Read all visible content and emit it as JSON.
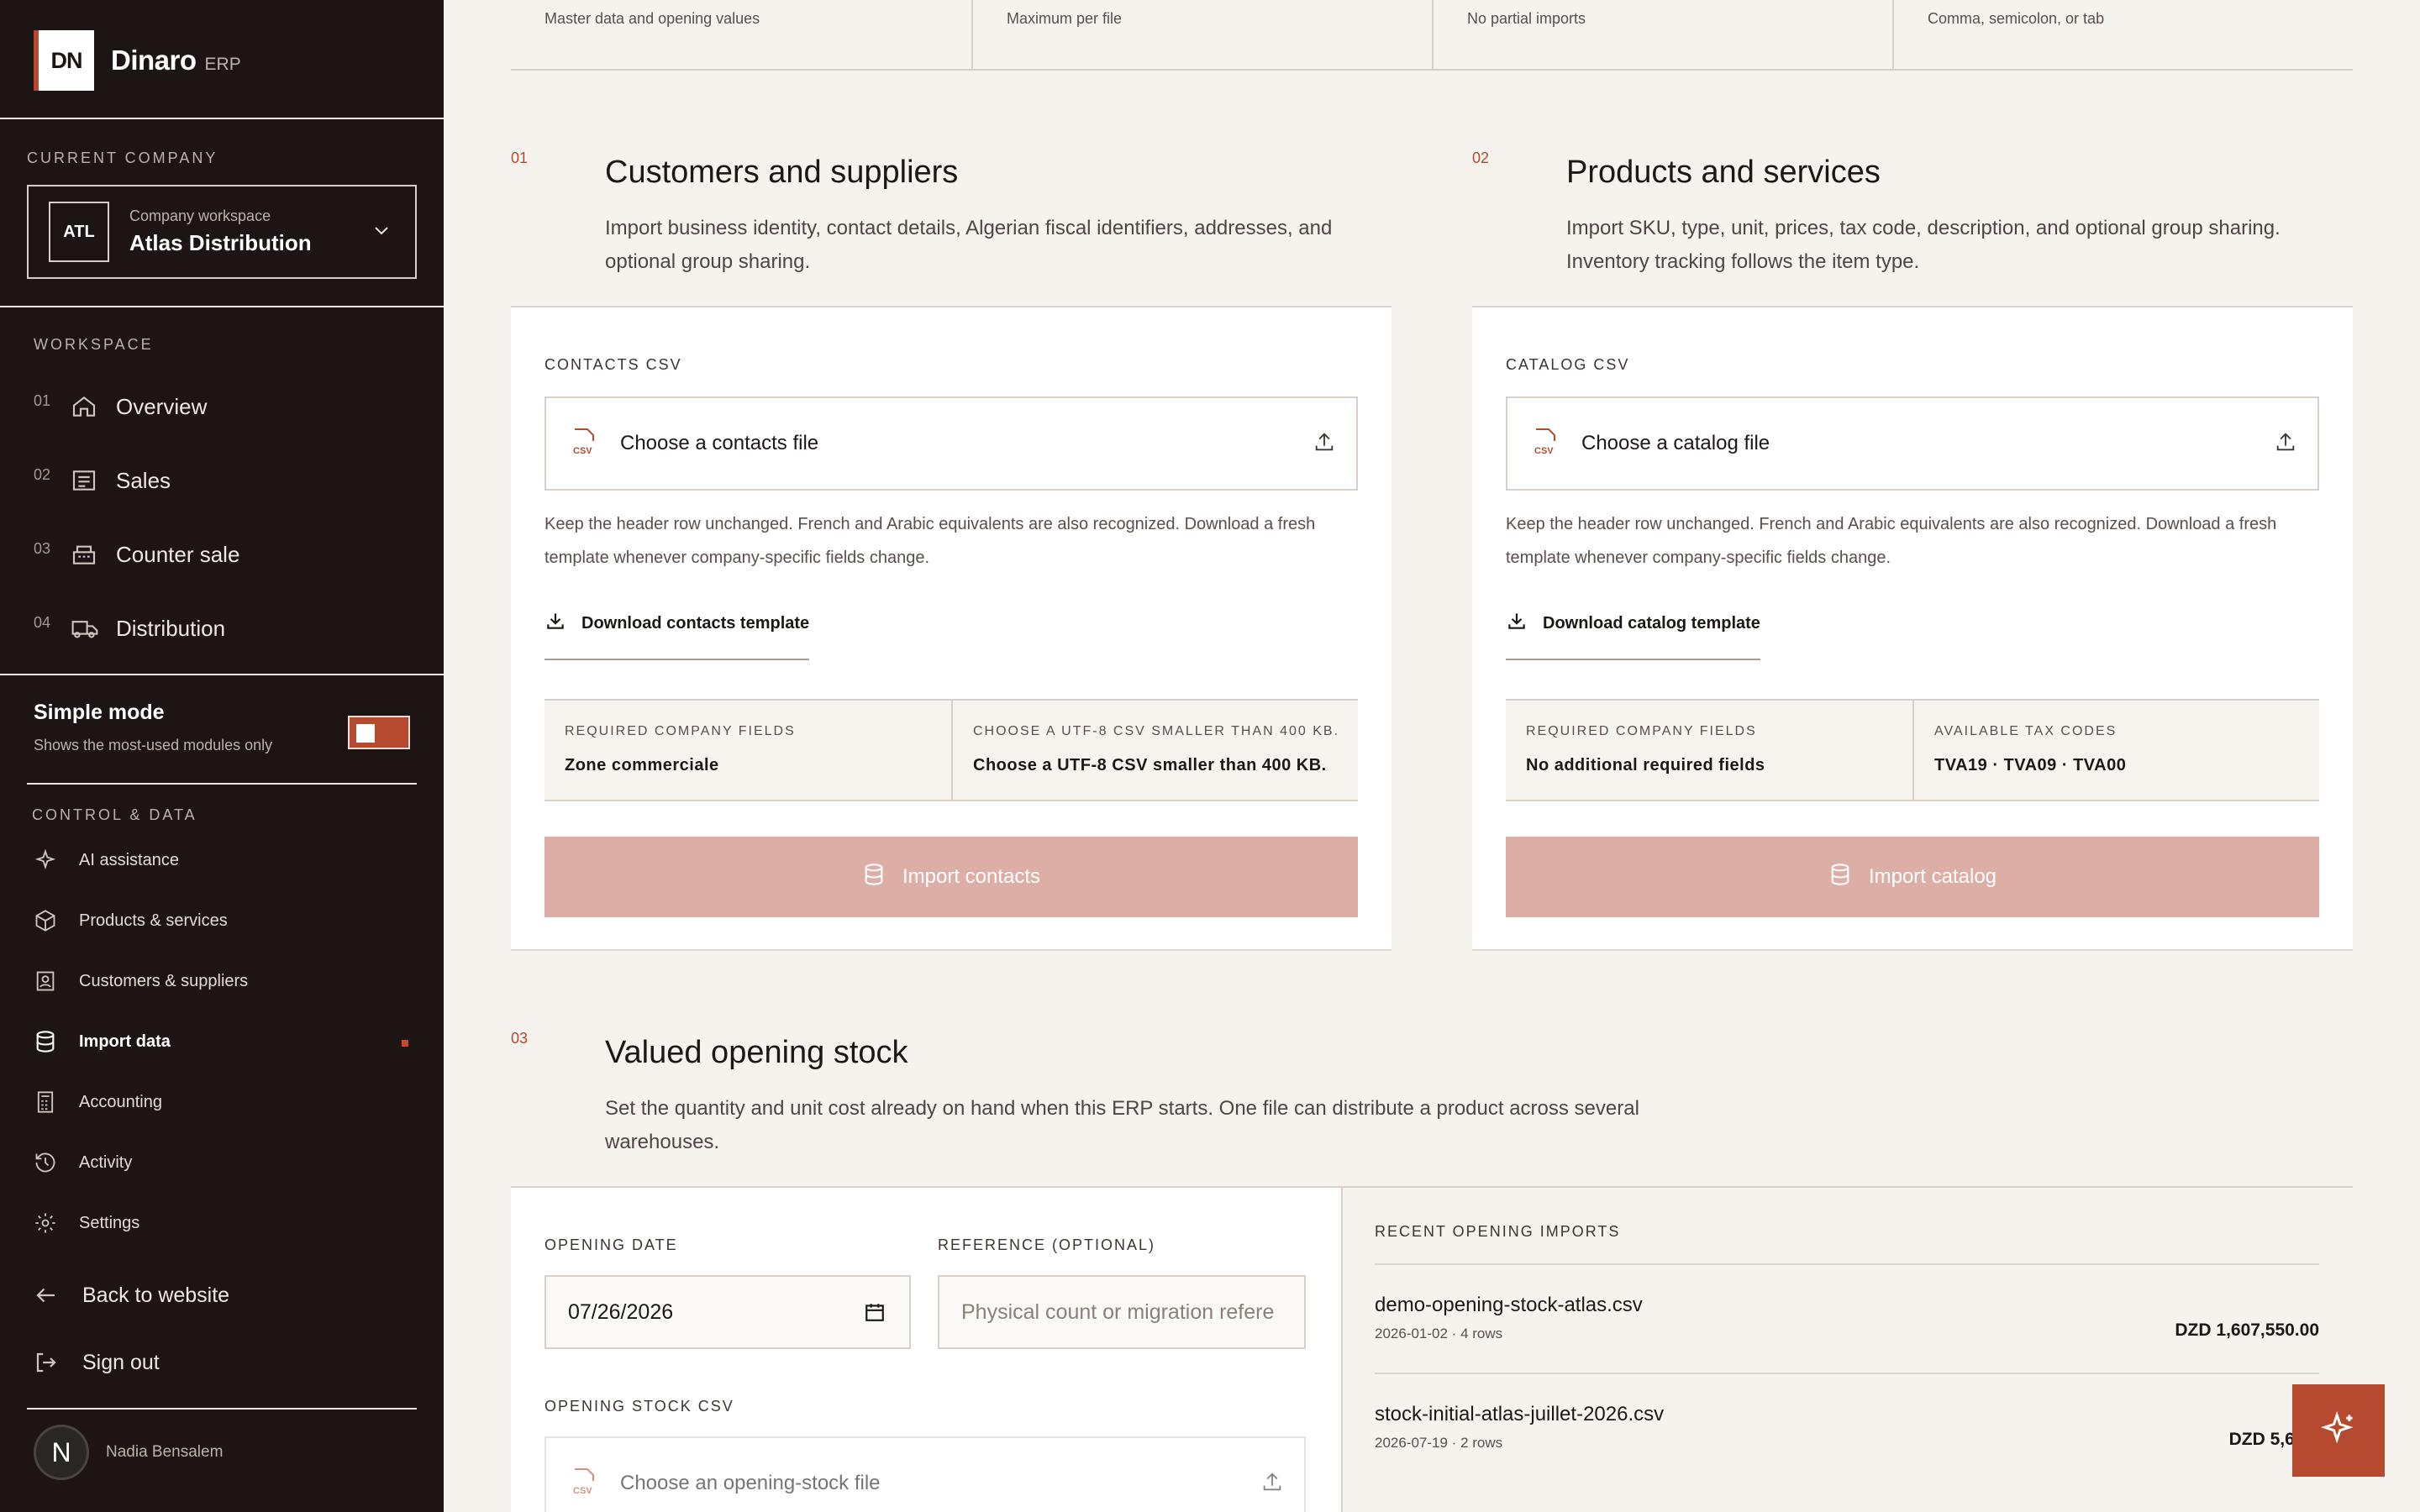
{
  "brand": {
    "logo": "DN",
    "name": "Dinaro",
    "suffix": "ERP"
  },
  "company": {
    "section_label": "CURRENT COMPANY",
    "badge": "ATL",
    "small": "Company workspace",
    "name": "Atlas Distribution"
  },
  "workspace": {
    "label": "WORKSPACE",
    "items": [
      {
        "num": "01",
        "label": "Overview",
        "icon": "home-icon"
      },
      {
        "num": "02",
        "label": "Sales",
        "icon": "receipt-icon"
      },
      {
        "num": "03",
        "label": "Counter sale",
        "icon": "register-icon"
      },
      {
        "num": "04",
        "label": "Distribution",
        "icon": "truck-icon"
      }
    ]
  },
  "simple_mode": {
    "title": "Simple mode",
    "subtitle": "Shows the most-used modules only",
    "enabled": true
  },
  "control": {
    "label": "CONTROL & DATA",
    "items": [
      {
        "label": "AI assistance",
        "icon": "sparkle-icon"
      },
      {
        "label": "Products & services",
        "icon": "box-icon"
      },
      {
        "label": "Customers & suppliers",
        "icon": "contact-icon"
      },
      {
        "label": "Import data",
        "icon": "database-icon",
        "active": true
      },
      {
        "label": "Accounting",
        "icon": "calculator-icon"
      },
      {
        "label": "Activity",
        "icon": "history-icon"
      },
      {
        "label": "Settings",
        "icon": "gear-icon"
      }
    ]
  },
  "bottom": {
    "back": "Back to website",
    "signout": "Sign out"
  },
  "user": {
    "initial": "N",
    "name": "Nadia Bensalem"
  },
  "strip": [
    "Master data and opening values",
    "Maximum per file",
    "No partial imports",
    "Comma, semicolon, or tab"
  ],
  "contacts": {
    "num": "01",
    "title": "Customers and suppliers",
    "desc": "Import business identity, contact details, Algerian fiscal identifiers, addresses, and optional group sharing.",
    "card_label": "CONTACTS CSV",
    "file_placeholder": "Choose a contacts file",
    "hint": "Keep the header row unchanged. French and Arabic equivalents are also recognized. Download a fresh template whenever company-specific fields change.",
    "download": "Download contacts template",
    "info": [
      {
        "label": "REQUIRED COMPANY FIELDS",
        "value": "Zone commerciale"
      },
      {
        "label": "CHOOSE A UTF-8 CSV SMALLER THAN 400 KB.",
        "value": "Choose a UTF-8 CSV smaller than 400 KB."
      }
    ],
    "button": "Import contacts"
  },
  "catalog": {
    "num": "02",
    "title": "Products and services",
    "desc": "Import SKU, type, unit, prices, tax code, description, and optional group sharing. Inventory tracking follows the item type.",
    "card_label": "CATALOG CSV",
    "file_placeholder": "Choose a catalog file",
    "hint": "Keep the header row unchanged. French and Arabic equivalents are also recognized. Download a fresh template whenever company-specific fields change.",
    "download": "Download catalog template",
    "info": [
      {
        "label": "REQUIRED COMPANY FIELDS",
        "value": "No additional required fields"
      },
      {
        "label": "AVAILABLE TAX CODES",
        "value": "TVA19 · TVA09 · TVA00"
      }
    ],
    "button": "Import catalog"
  },
  "stock": {
    "num": "03",
    "title": "Valued opening stock",
    "desc": "Set the quantity and unit cost already on hand when this ERP starts. One file can distribute a product across several warehouses.",
    "date_label": "OPENING DATE",
    "date_value": "07/26/2026",
    "ref_label": "REFERENCE (OPTIONAL)",
    "ref_placeholder": "Physical count or migration refere",
    "csv_label": "OPENING STOCK CSV",
    "file_placeholder": "Choose an opening-stock file"
  },
  "recent": {
    "label": "RECENT OPENING IMPORTS",
    "rows": [
      {
        "name": "demo-opening-stock-atlas.csv",
        "meta": "2026-01-02 · 4 rows",
        "amount": "DZD 1,607,550.00"
      },
      {
        "name": "stock-initial-atlas-juillet-2026.csv",
        "meta": "2026-07-19 · 2 rows",
        "amount": "DZD 5,605."
      }
    ]
  },
  "colors": {
    "accent": "#b64a2e",
    "sidebar": "#1c1514",
    "button_disabled": "#ddaea5"
  }
}
